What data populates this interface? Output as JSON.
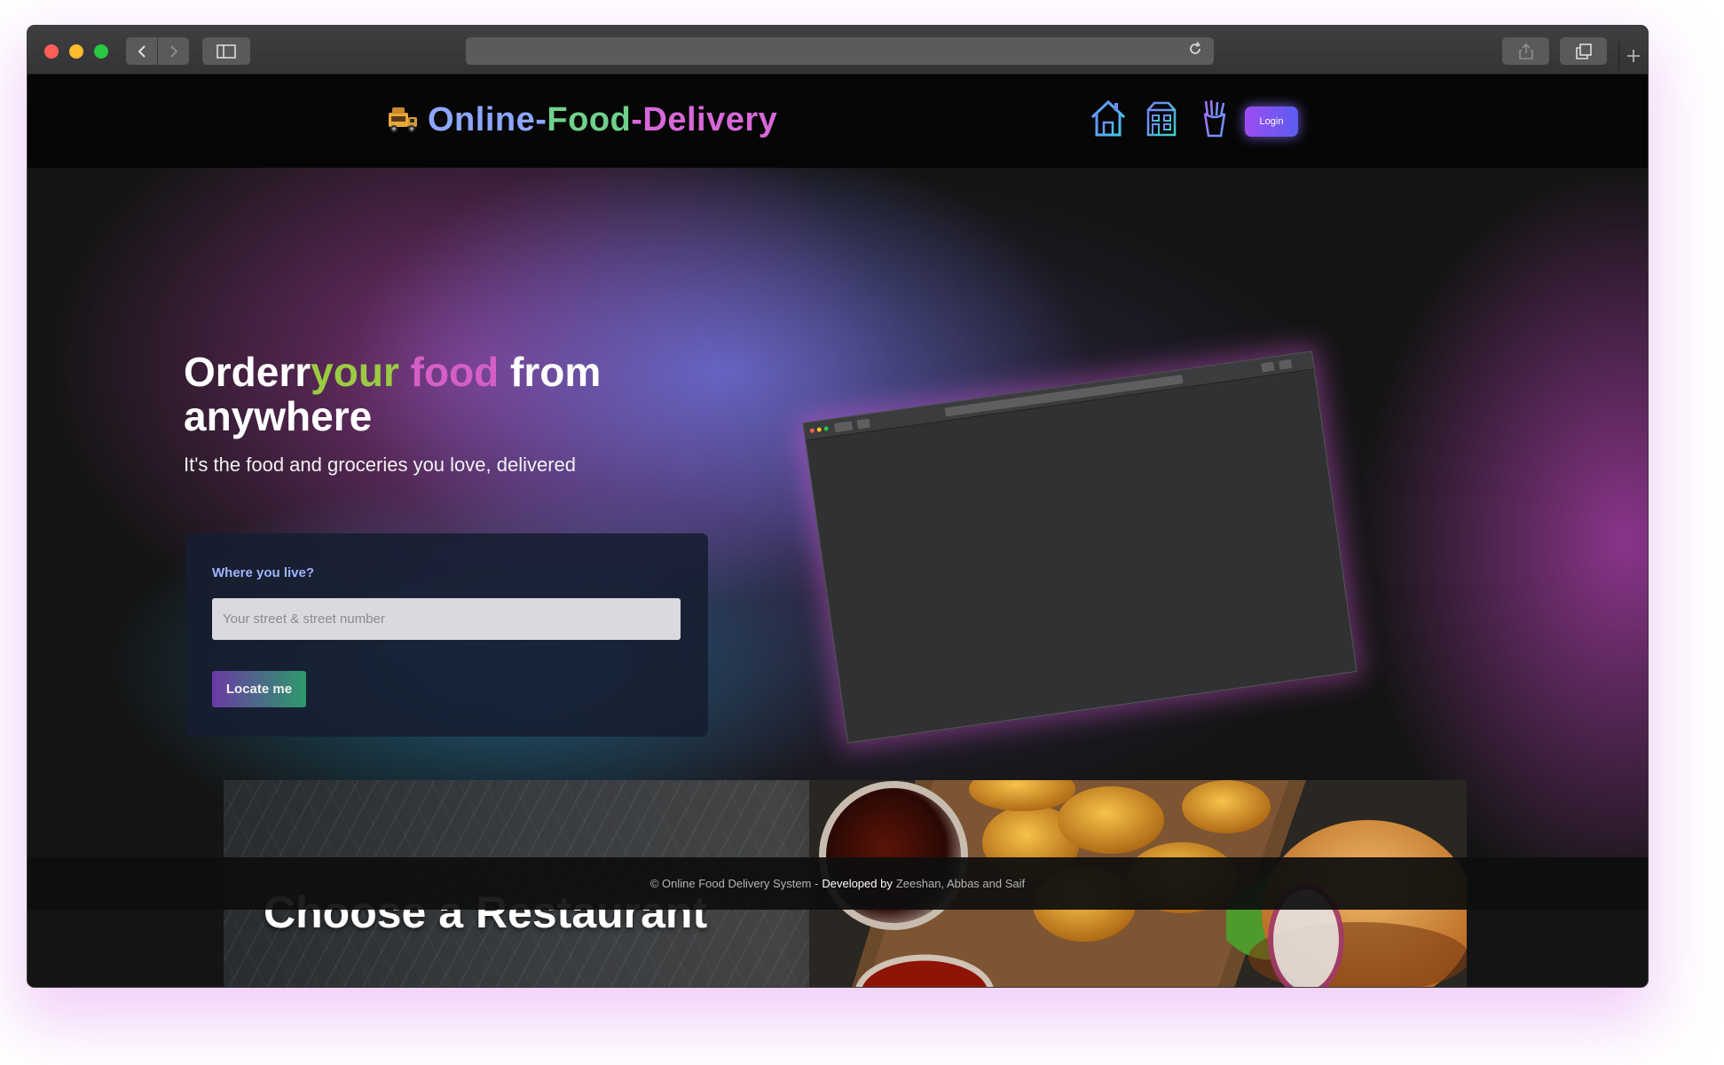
{
  "browser": {
    "back_icon": "chevron-left-icon",
    "forward_icon": "chevron-right-icon",
    "sidebar_icon": "sidebar-icon",
    "reload_icon": "reload-icon",
    "share_icon": "share-icon",
    "tabs_icon": "tabs-icon",
    "new_tab_icon": "plus-icon"
  },
  "navbar": {
    "brand_part1": "Online-",
    "brand_part2": "Food",
    "brand_part3": "-Delivery",
    "brand_icon": "food-truck-icon",
    "nav_icons": [
      "home-icon",
      "restaurants-icon",
      "fries-icon"
    ],
    "login_label": "Login",
    "colors": {
      "brand_blue": "#8da7ff",
      "brand_green": "#6fd18a",
      "brand_pink": "#d768d8",
      "login_start": "#9d4df2",
      "login_end": "#5a5cf0"
    }
  },
  "hero": {
    "headline_1": "Orderr",
    "headline_2": "your",
    "headline_3": "food",
    "headline_4": "from anywhere",
    "subheadline": "It's the food and groceries you love, delivered",
    "location": {
      "label": "Where you live?",
      "input_placeholder": "Your street & street number",
      "input_value": "",
      "button_label": "Locate me"
    }
  },
  "banner": {
    "title": "Choose a Restaurant"
  },
  "footer": {
    "copyright": "© Online Food Delivery System -",
    "developed_by": "Developed by",
    "developers": "Zeeshan, Abbas and Saif"
  }
}
